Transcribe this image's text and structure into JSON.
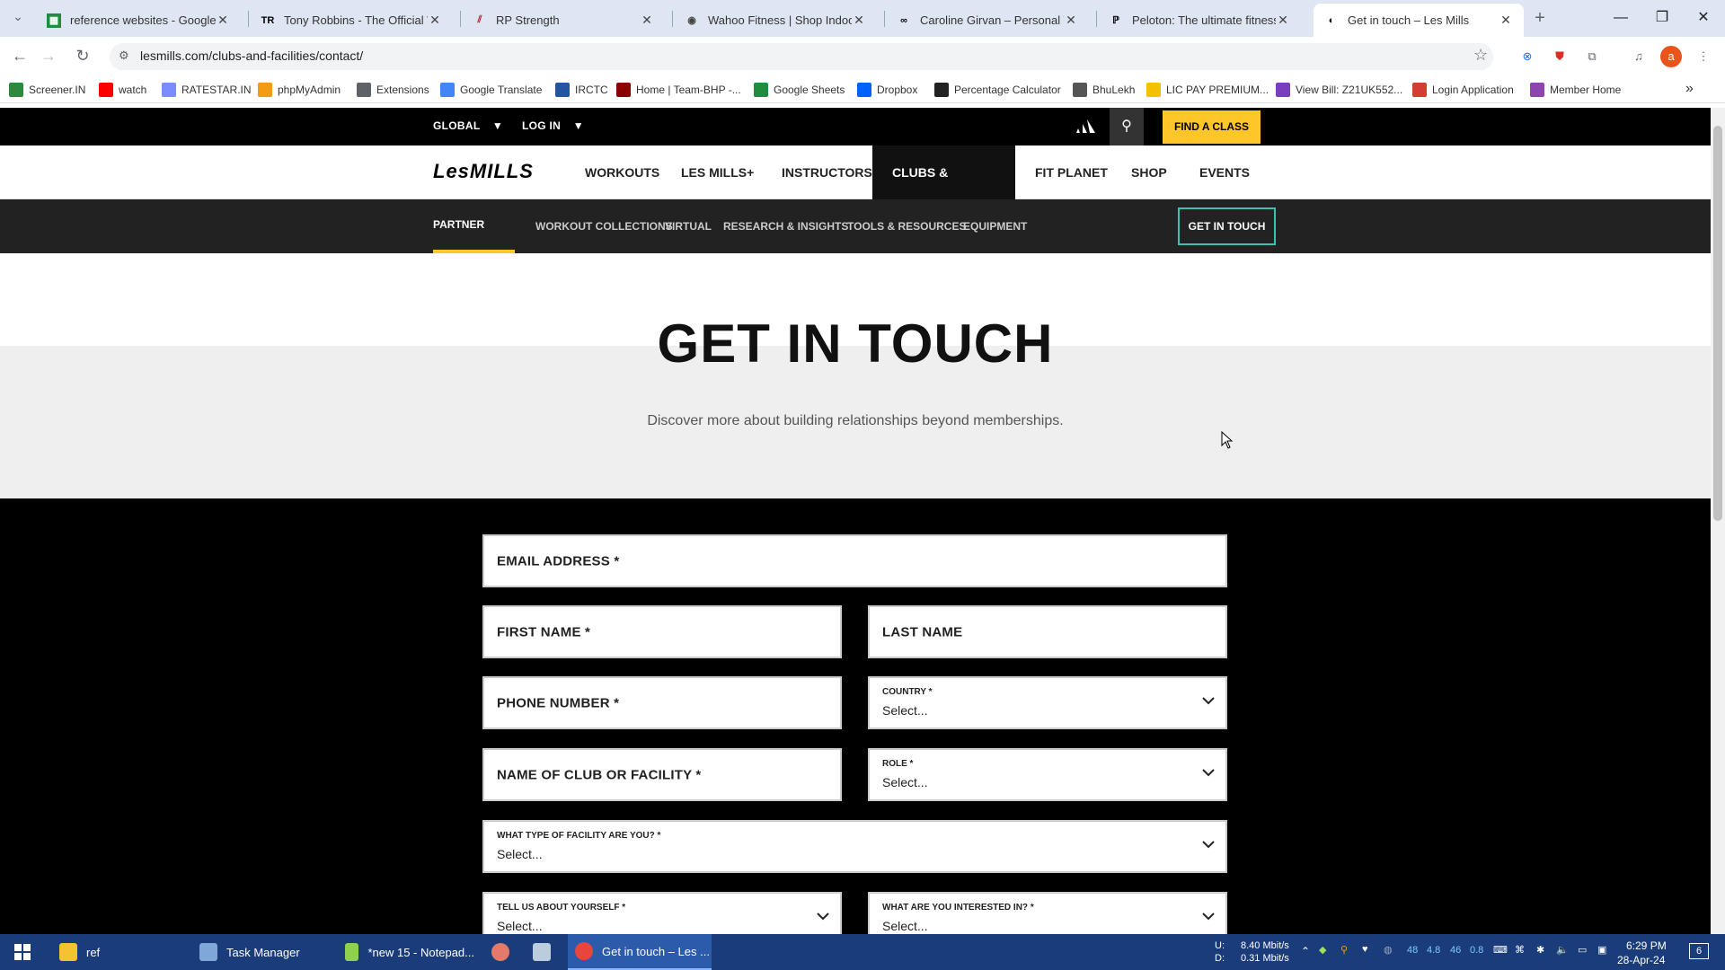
{
  "browser": {
    "tabs": [
      {
        "title": "reference websites - Google Sh",
        "icon": "sheets-icon",
        "color": "#1e8e3e"
      },
      {
        "title": "Tony Robbins - The Official Wel",
        "icon": "tr-icon",
        "color": "#000000"
      },
      {
        "title": "RP Strength",
        "icon": "rp-icon",
        "color": "#c4161c"
      },
      {
        "title": "Wahoo Fitness | Shop Indoor B",
        "icon": "wahoo-icon",
        "color": "#444444"
      },
      {
        "title": "Caroline Girvan – Personal Trai",
        "icon": "cg-icon",
        "color": "#000000"
      },
      {
        "title": "Peloton: The ultimate fitness ex",
        "icon": "peloton-icon",
        "color": "#000000"
      },
      {
        "title": "Get in touch – Les Mills",
        "icon": "lesmills-icon",
        "color": "#000000"
      }
    ],
    "active_tab": 6,
    "url": "lesmills.com/clubs-and-facilities/contact/",
    "bookmarks": [
      {
        "label": "Screener.IN",
        "color": "#2b8a3e"
      },
      {
        "label": "watch",
        "color": "#ff0000"
      },
      {
        "label": "RATESTAR.IN",
        "color": "#7a8cff"
      },
      {
        "label": "phpMyAdmin",
        "color": "#f39c12"
      },
      {
        "label": "Extensions",
        "color": "#5f6368"
      },
      {
        "label": "Google Translate",
        "color": "#4285f4"
      },
      {
        "label": "IRCTC",
        "color": "#2554a4"
      },
      {
        "label": "Home | Team-BHP -...",
        "color": "#8b0000"
      },
      {
        "label": "Google Sheets",
        "color": "#1e8e3e"
      },
      {
        "label": "Dropbox",
        "color": "#0061fe"
      },
      {
        "label": "Percentage Calculator",
        "color": "#222222"
      },
      {
        "label": "BhuLekh",
        "color": "#555555"
      },
      {
        "label": "LIC PAY PREMIUM...",
        "color": "#f2c200"
      },
      {
        "label": "View Bill: Z21UK552...",
        "color": "#7a3fbf"
      },
      {
        "label": "Login Application",
        "color": "#d23f31"
      },
      {
        "label": "Member Home",
        "color": "#8e44ad"
      }
    ],
    "overflow_label": "»"
  },
  "site": {
    "util": {
      "global": "GLOBAL",
      "login": "LOG IN",
      "find_class": "FIND A CLASS"
    },
    "logo": "LesMILLS",
    "main_nav": [
      "WORKOUTS",
      "LES MILLS+",
      "INSTRUCTORS",
      "CLUBS & FACILITIES",
      "FIT PLANET",
      "SHOP",
      "EVENTS"
    ],
    "sub_nav": [
      "PARTNER WITH US",
      "WORKOUT COLLECTIONS",
      "VIRTUAL",
      "RESEARCH & INSIGHTS",
      "TOOLS & RESOURCES",
      "EQUIPMENT"
    ],
    "get_in_touch_button": "GET IN TOUCH",
    "hero": {
      "title": "GET IN TOUCH",
      "subtitle": "Discover more about building relationships beyond memberships."
    },
    "form": {
      "email": "EMAIL ADDRESS *",
      "first_name": "FIRST NAME *",
      "last_name": "LAST NAME",
      "phone": "PHONE NUMBER *",
      "country": {
        "label": "COUNTRY *",
        "value": "Select..."
      },
      "club": "NAME OF CLUB OR FACILITY *",
      "role": {
        "label": "ROLE *",
        "value": "Select..."
      },
      "facility_type": {
        "label": "WHAT TYPE OF FACILITY ARE YOU? *",
        "value": "Select..."
      },
      "about": {
        "label": "TELL US ABOUT YOURSELF *",
        "value": "Select..."
      },
      "interest": {
        "label": "WHAT ARE YOU INTERESTED IN? *",
        "value": "Select..."
      }
    },
    "colors": {
      "accent": "#ffc629",
      "teal": "#3cc0b0"
    }
  },
  "taskbar": {
    "items": [
      "ref",
      "Task Manager",
      "*new 15 - Notepad...",
      "",
      "",
      "Get in touch – Les ..."
    ],
    "net_up_label": "U:",
    "net_down_label": "D:",
    "net_up": "8.40 Mbit/s",
    "net_down": "0.31 Mbit/s",
    "tray_nums": [
      "48",
      "4.8",
      "46",
      "0.8"
    ],
    "time": "6:29 PM",
    "date": "28-Apr-24",
    "notifications": "6"
  }
}
